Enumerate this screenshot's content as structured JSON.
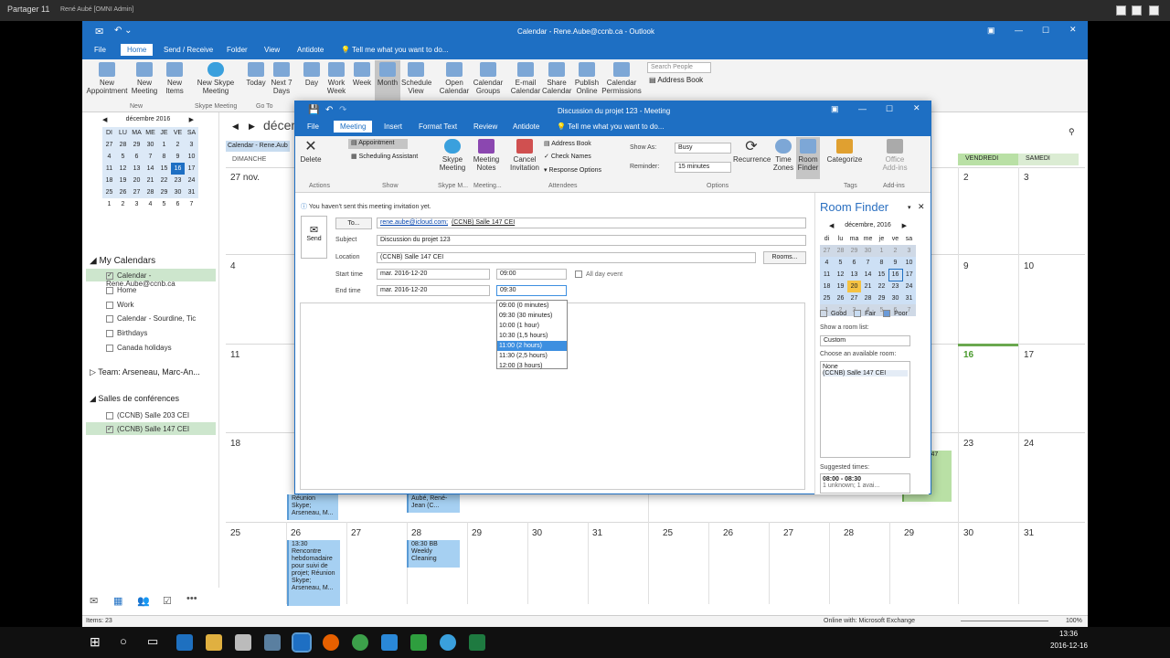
{
  "rdp": {
    "title": "Partager 11",
    "user": "René Aubé [OMNI Admin]"
  },
  "outlook": {
    "title": "Calendar - Rene.Aube@ccnb.ca - Outlook",
    "tabs": [
      "File",
      "Home",
      "Send / Receive",
      "Folder",
      "View",
      "Antidote",
      "Tell me what you want to do..."
    ],
    "ribbon": {
      "new_appointment": "New Appointment",
      "new_meeting": "New Meeting",
      "new_items": "New Items",
      "new_skype": "New Skype Meeting",
      "today": "Today",
      "next7": "Next 7 Days",
      "day": "Day",
      "work_week": "Work Week",
      "week": "Week",
      "month": "Month",
      "schedule": "Schedule View",
      "open_cal": "Open Calendar",
      "cal_groups": "Calendar Groups",
      "email_cal": "E-mail Calendar",
      "share_cal": "Share Calendar",
      "publish": "Publish Online",
      "cal_perm": "Calendar Permissions",
      "search_people": "Search People",
      "address_book": "Address Book",
      "grp_new": "New",
      "grp_skype": "Skype Meeting",
      "grp_goto": "Go To"
    },
    "minical": {
      "month": "décembre 2016",
      "dow": [
        "DI",
        "LU",
        "MA",
        "ME",
        "JE",
        "VE",
        "SA"
      ],
      "weeks": [
        [
          "27",
          "28",
          "29",
          "30",
          "1",
          "2",
          "3"
        ],
        [
          "4",
          "5",
          "6",
          "7",
          "8",
          "9",
          "10"
        ],
        [
          "11",
          "12",
          "13",
          "14",
          "15",
          "16",
          "17"
        ],
        [
          "18",
          "19",
          "20",
          "21",
          "22",
          "23",
          "24"
        ],
        [
          "25",
          "26",
          "27",
          "28",
          "29",
          "30",
          "31"
        ],
        [
          "1",
          "2",
          "3",
          "4",
          "5",
          "6",
          "7"
        ]
      ]
    },
    "nav": {
      "my_calendars": "My Calendars",
      "cal_main": "Calendar - Rene.Aube@ccnb.ca",
      "home": "Home",
      "work": "Work",
      "sourdine": "Calendar - Sourdine, Tic",
      "birthdays": "Birthdays",
      "holidays": "Canada holidays",
      "team": "Team: Arseneau, Marc-An...",
      "salles": "Salles de conférences",
      "salle203": "(CCNB) Salle 203 CEI",
      "salle147": "(CCNB) Salle 147 CEI"
    },
    "grid": {
      "header_month": "décem",
      "left_cal_label": "Calendar - Rene.Aub",
      "dimanche": "DIMANCHE",
      "vendredi": "VENDREDI",
      "samedi": "SAMEDI",
      "r1": [
        "27 nov.",
        "2",
        "3"
      ],
      "r2": [
        "4",
        "9",
        "10"
      ],
      "r3": [
        "11",
        "16",
        "17"
      ],
      "r4": [
        "18",
        "23",
        "24"
      ],
      "r5": [
        "25",
        "26",
        "27",
        "28",
        "29",
        "30",
        "31",
        "25",
        "26",
        "27",
        "28",
        "29",
        "30",
        "31"
      ],
      "evt1": "Réunion Skype; Arseneau, M...",
      "evt2": "Aubé, René-Jean (C...",
      "evt3": "13:30 Rencontre hebdomadaire pour suivi de projet; Réunion Skype; Arseneau, M...",
      "evt4": "08:30 BB Weekly Cleaning",
      "evt5": "aaa; 147 CEI"
    },
    "status": {
      "items": "Items: 23",
      "exchange": "Online with: Microsoft Exchange",
      "zoom": "100%"
    }
  },
  "meeting": {
    "title": "Discussion du projet 123 - Meeting",
    "tabs": [
      "File",
      "Meeting",
      "Insert",
      "Format Text",
      "Review",
      "Antidote",
      "Tell me what you want to do..."
    ],
    "ribbon": {
      "delete": "Delete",
      "appointment": "Appointment",
      "sched_asst": "Scheduling Assistant",
      "skype": "Skype Meeting",
      "notes": "Meeting Notes",
      "cancel": "Cancel Invitation",
      "addr_book": "Address Book",
      "check_names": "Check Names",
      "resp_opts": "Response Options",
      "show_as": "Show As:",
      "show_as_val": "Busy",
      "reminder": "Reminder:",
      "reminder_val": "15 minutes",
      "recurrence": "Recurrence",
      "time_zones": "Time Zones",
      "room_finder": "Room Finder",
      "categorize": "Categorize",
      "office_addins": "Office Add-ins",
      "g_actions": "Actions",
      "g_show": "Show",
      "g_skype": "Skype M...",
      "g_meeting": "Meeting...",
      "g_attendees": "Attendees",
      "g_options": "Options",
      "g_tags": "Tags",
      "g_addins": "Add-ins"
    },
    "info": "You haven't sent this meeting invitation yet.",
    "send": "Send",
    "to_btn": "To...",
    "to_val1": "rene.aube@icloud.com;",
    "to_val2": "(CCNB) Salle 147 CEI",
    "subject_lbl": "Subject",
    "subject": "Discussion du projet 123",
    "location_lbl": "Location",
    "location": "(CCNB) Salle 147 CEI",
    "rooms_btn": "Rooms...",
    "start_lbl": "Start time",
    "start_date": "mar. 2016-12-20",
    "start_time": "09:00",
    "allday": "All day event",
    "end_lbl": "End time",
    "end_date": "mar. 2016-12-20",
    "end_time": "09:30",
    "dropdown": [
      "09:00 (0 minutes)",
      "09:30 (30 minutes)",
      "10:00 (1 hour)",
      "10:30 (1,5 hours)",
      "11:00 (2 hours)",
      "11:30 (2,5 hours)",
      "12:00 (3 hours)"
    ]
  },
  "roomfinder": {
    "title": "Room Finder",
    "month": "décembre, 2016",
    "dow": [
      "di",
      "lu",
      "ma",
      "me",
      "je",
      "ve",
      "sa"
    ],
    "weeks": [
      [
        "27",
        "28",
        "29",
        "30",
        "1",
        "2",
        "3"
      ],
      [
        "4",
        "5",
        "6",
        "7",
        "8",
        "9",
        "10"
      ],
      [
        "11",
        "12",
        "13",
        "14",
        "15",
        "16",
        "17"
      ],
      [
        "18",
        "19",
        "20",
        "21",
        "22",
        "23",
        "24"
      ],
      [
        "25",
        "26",
        "27",
        "28",
        "29",
        "30",
        "31"
      ],
      [
        "1",
        "2",
        "3",
        "4",
        "5",
        "6",
        "7"
      ]
    ],
    "good": "Good",
    "fair": "Fair",
    "poor": "Poor",
    "show_list": "Show a room list:",
    "list_val": "Custom",
    "choose": "Choose an available room:",
    "rooms": [
      "None",
      "(CCNB) Salle 147 CEI"
    ],
    "suggested": "Suggested times:",
    "sugg_time": "08:00 - 08:30",
    "sugg_info": "1 unknown; 1 avai..."
  },
  "taskbar": {
    "time": "13:36",
    "date": "2016-12-16"
  }
}
